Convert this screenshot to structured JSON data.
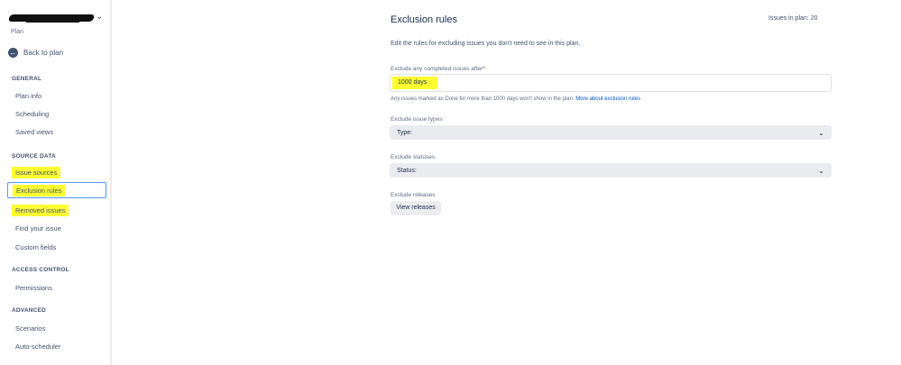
{
  "sidebar": {
    "plan_subtitle": "Plan",
    "back_label": "Back to plan",
    "groups": [
      {
        "title": "GENERAL",
        "items": [
          {
            "label": "Plan info"
          },
          {
            "label": "Scheduling"
          },
          {
            "label": "Saved views"
          }
        ]
      },
      {
        "title": "SOURCE DATA",
        "items": [
          {
            "label": "Issue sources"
          },
          {
            "label": "Exclusion rules"
          },
          {
            "label": "Removed issues"
          },
          {
            "label": "Find your issue"
          },
          {
            "label": "Custom fields"
          }
        ]
      },
      {
        "title": "ACCESS CONTROL",
        "items": [
          {
            "label": "Permissions"
          }
        ]
      },
      {
        "title": "ADVANCED",
        "items": [
          {
            "label": "Scenarios"
          },
          {
            "label": "Auto-scheduler"
          }
        ]
      }
    ],
    "active_item": "Exclusion rules"
  },
  "main": {
    "title": "Exclusion rules",
    "issues_in_plan": "Issues in plan: 20",
    "description": "Edit the rules for excluding issues you don't need to see in this plan.",
    "completed": {
      "label": "Exclude any completed issues after",
      "required_mark": "*",
      "value": "1000 days",
      "helper": "Any issues marked as Done for more than 1000 days won't show in the plan.",
      "helper_link": "More about exclusion rules"
    },
    "issue_types": {
      "label": "Exclude issue types",
      "placeholder": "Type:"
    },
    "statuses": {
      "label": "Exclude statuses",
      "placeholder": "Status:"
    },
    "releases": {
      "label": "Exclude releases",
      "button": "View releases"
    }
  },
  "colors": {
    "highlight": "#ffff33",
    "active_border": "#4c9aff",
    "link": "#0052cc"
  }
}
